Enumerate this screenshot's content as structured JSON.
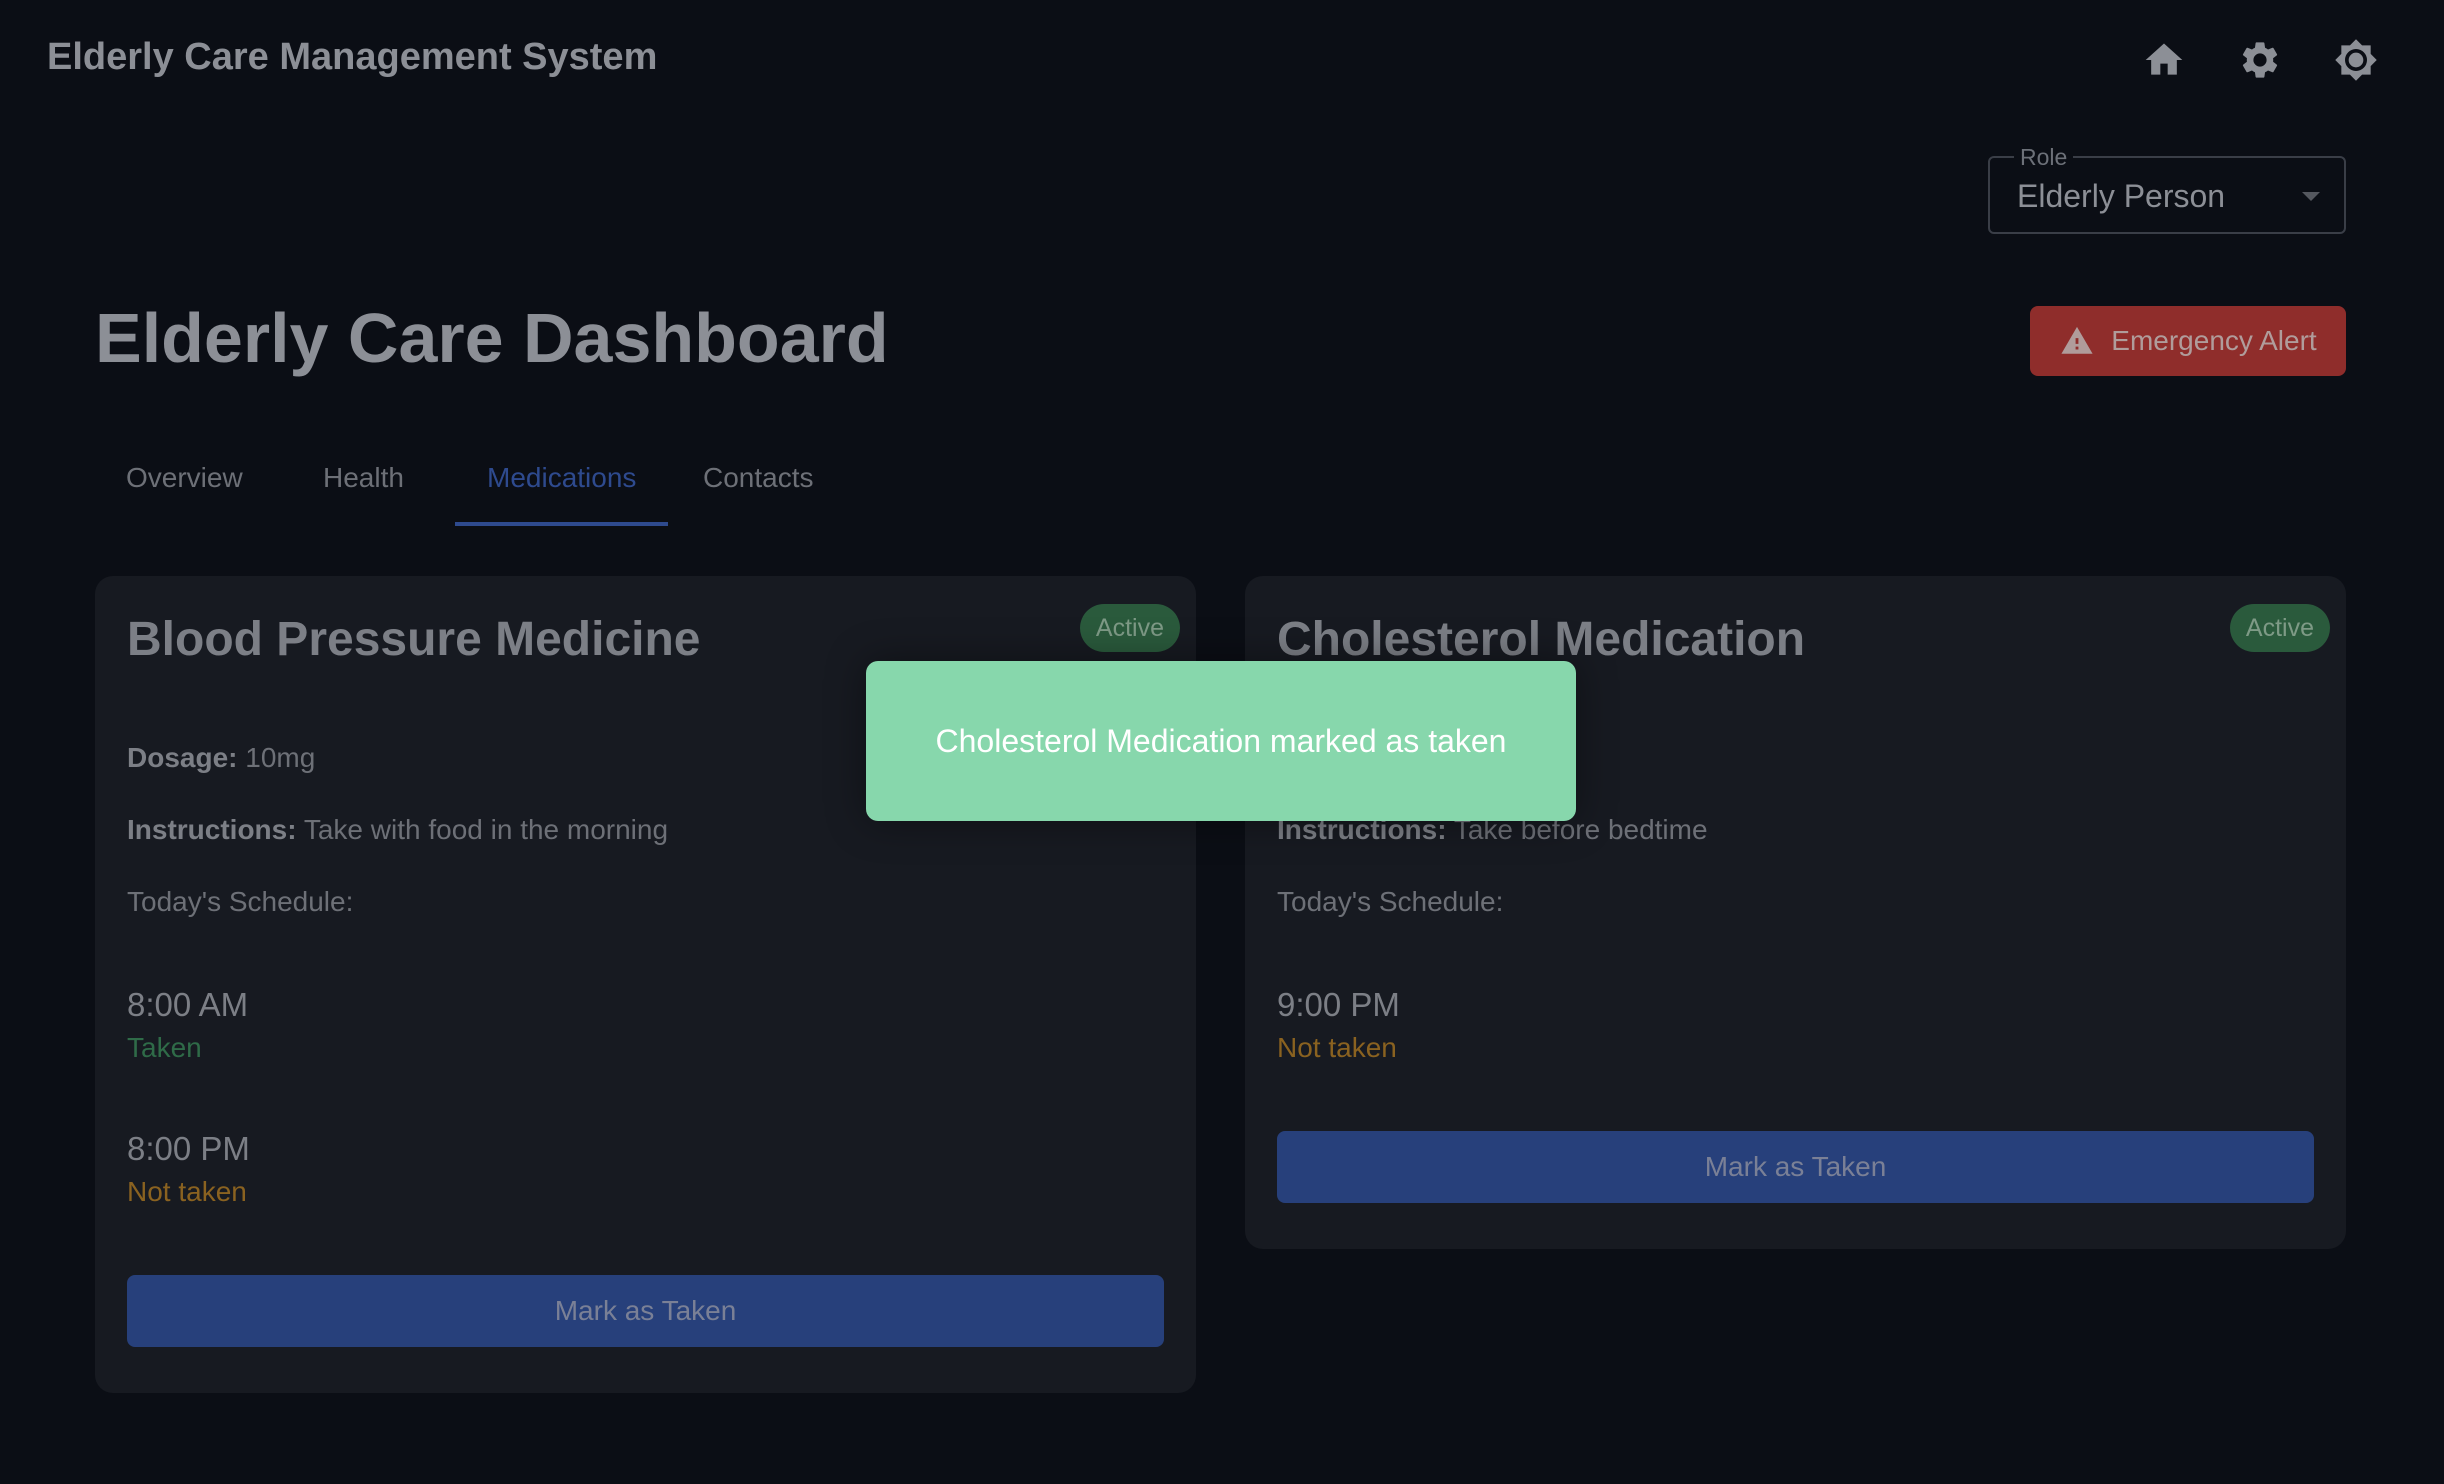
{
  "app": {
    "title": "Elderly Care Management System"
  },
  "header_icons": [
    "home-icon",
    "gear-icon",
    "brightness-icon"
  ],
  "role": {
    "label": "Role",
    "value": "Elderly Person"
  },
  "page": {
    "title": "Elderly Care Dashboard"
  },
  "emergency": {
    "label": "Emergency Alert"
  },
  "tabs": [
    {
      "label": "Overview",
      "active": false
    },
    {
      "label": "Health",
      "active": false
    },
    {
      "label": "Medications",
      "active": true
    },
    {
      "label": "Contacts",
      "active": false
    }
  ],
  "medications": [
    {
      "name": "Blood Pressure Medicine",
      "badge": "Active",
      "dosage_label": "Dosage:",
      "dosage": "10mg",
      "instructions_label": "Instructions:",
      "instructions": "Take with food in the morning",
      "schedule_label": "Today's Schedule:",
      "schedule": [
        {
          "time": "8:00 AM",
          "status": "Taken"
        },
        {
          "time": "8:00 PM",
          "status": "Not taken"
        }
      ],
      "button": "Mark as Taken"
    },
    {
      "name": "Cholesterol Medication",
      "badge": "Active",
      "instructions_label": "Instructions:",
      "instructions": "Take before bedtime",
      "schedule_label": "Today's Schedule:",
      "schedule": [
        {
          "time": "9:00 PM",
          "status": "Not taken"
        }
      ],
      "button": "Mark as Taken"
    }
  ],
  "toast": {
    "message": "Cholesterol Medication marked as taken"
  },
  "colors": {
    "background": "#0b0e15",
    "card": "#171a21",
    "accent": "#2e4a8e",
    "emergency": "#8f2d2b",
    "taken": "#2f6b48",
    "not_taken": "#8a6220",
    "toast": "#87d7ac"
  }
}
